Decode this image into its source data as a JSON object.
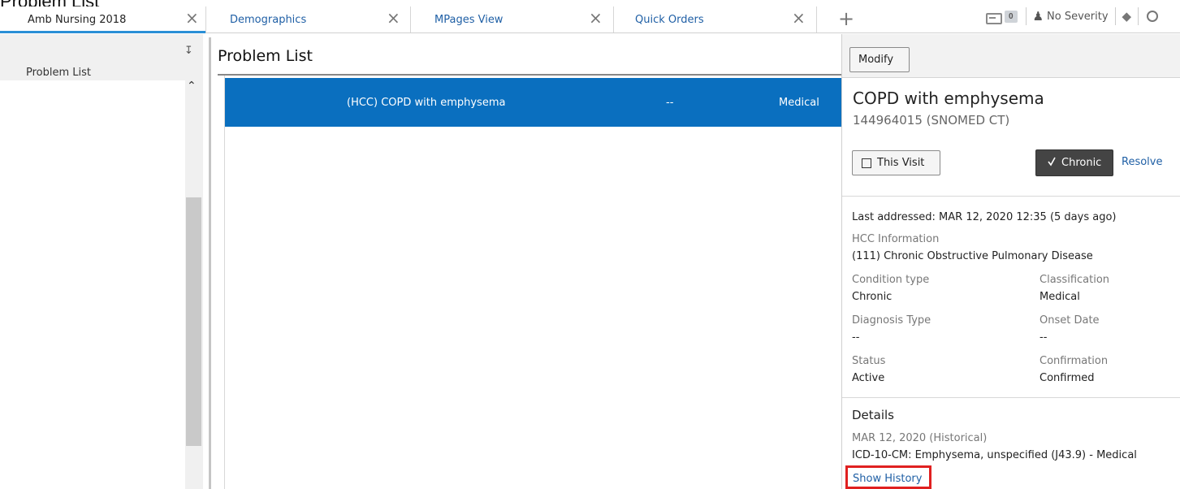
{
  "page_heading": "Problem List",
  "tabs": [
    {
      "label": "Amb Nursing 2018",
      "active": true
    },
    {
      "label": "Demographics",
      "active": false
    },
    {
      "label": "MPages View",
      "active": false
    },
    {
      "label": "Quick Orders",
      "active": false
    }
  ],
  "toolbar": {
    "message_count": "0",
    "severity": "No Severity"
  },
  "left_panel": {
    "tab_label": "Problem List"
  },
  "center": {
    "title": "Problem List",
    "selected_row": {
      "name": "(HCC) COPD with emphysema",
      "middle": "--",
      "classification": "Medical"
    }
  },
  "detail": {
    "modify_label": "Modify",
    "name": "COPD with emphysema",
    "code": "144964015 (SNOMED CT)",
    "this_visit_label": "This Visit",
    "chronic_label": "Chronic",
    "resolve_label": "Resolve",
    "last_addressed": "Last addressed: MAR 12, 2020 12:35 (5 days ago)",
    "hcc_label": "HCC Information",
    "hcc_value": "(111) Chronic Obstructive Pulmonary Disease",
    "condition_type_label": "Condition type",
    "condition_type_value": "Chronic",
    "classification_label": "Classification",
    "classification_value": "Medical",
    "diagnosis_type_label": "Diagnosis Type",
    "diagnosis_type_value": "--",
    "onset_date_label": "Onset Date",
    "onset_date_value": "--",
    "status_label": "Status",
    "status_value": "Active",
    "confirmation_label": "Confirmation",
    "confirmation_value": "Confirmed",
    "details_heading": "Details",
    "details_date": "MAR 12, 2020 (Historical)",
    "details_icd": "ICD-10-CM: Emphysema, unspecified (J43.9) - Medical",
    "show_history_label": "Show History"
  }
}
